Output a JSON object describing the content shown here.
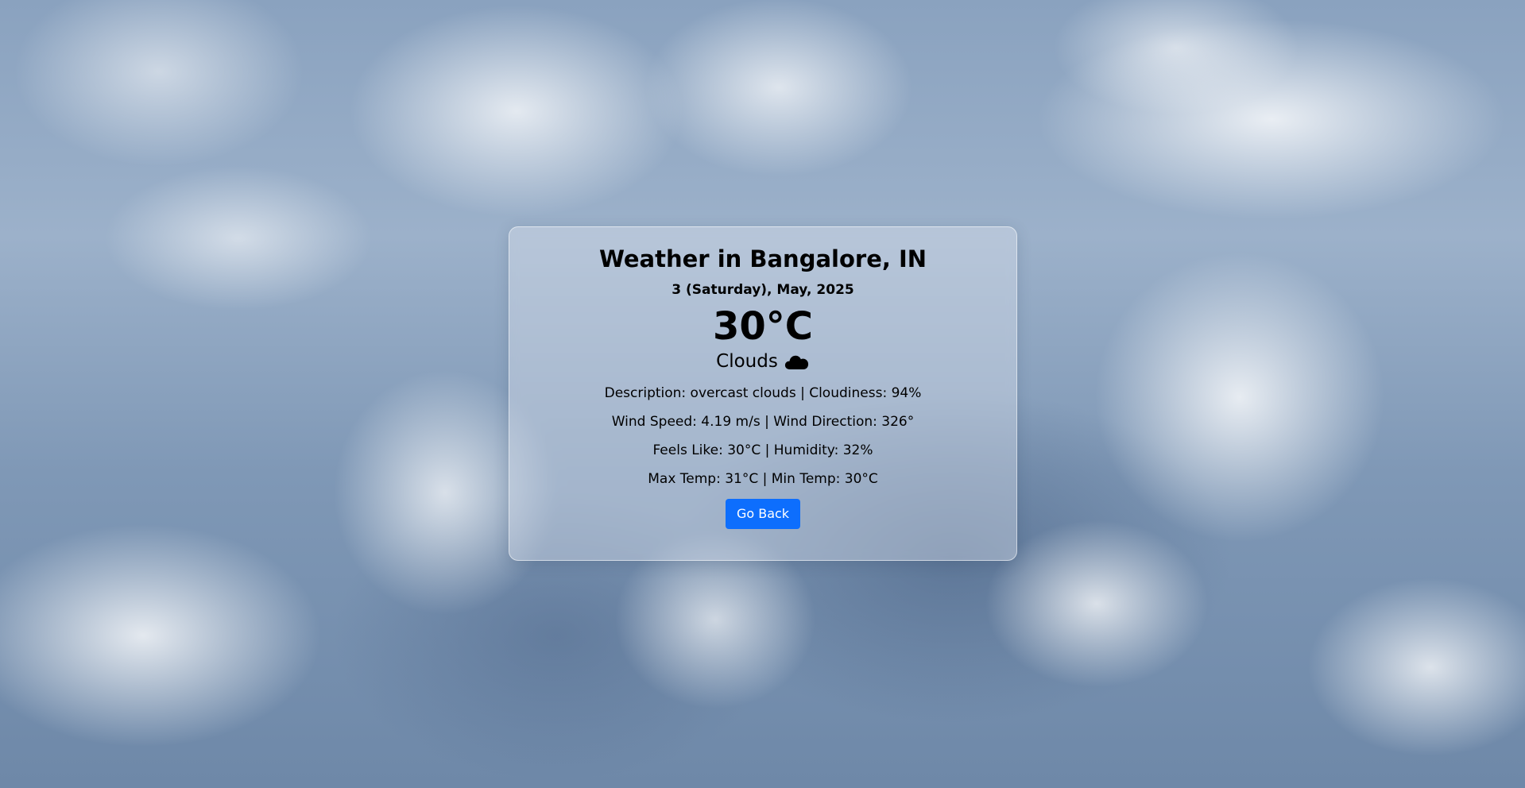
{
  "weather": {
    "title": "Weather in Bangalore, IN",
    "date": "3 (Saturday), May, 2025",
    "temperature": "30°C",
    "condition": "Clouds",
    "condition_icon": "cloud-icon",
    "details": {
      "description_line": "Description: overcast clouds | Cloudiness: 94%",
      "wind_line": "Wind Speed: 4.19 m/s | Wind Direction: 326°",
      "feels_line": "Feels Like: 30°C | Humidity: 32%",
      "temp_range_line": "Max Temp: 31°C | Min Temp: 30°C"
    },
    "back_button_label": "Go Back"
  },
  "colors": {
    "button_bg": "#0d6efd",
    "button_text": "#ffffff"
  }
}
